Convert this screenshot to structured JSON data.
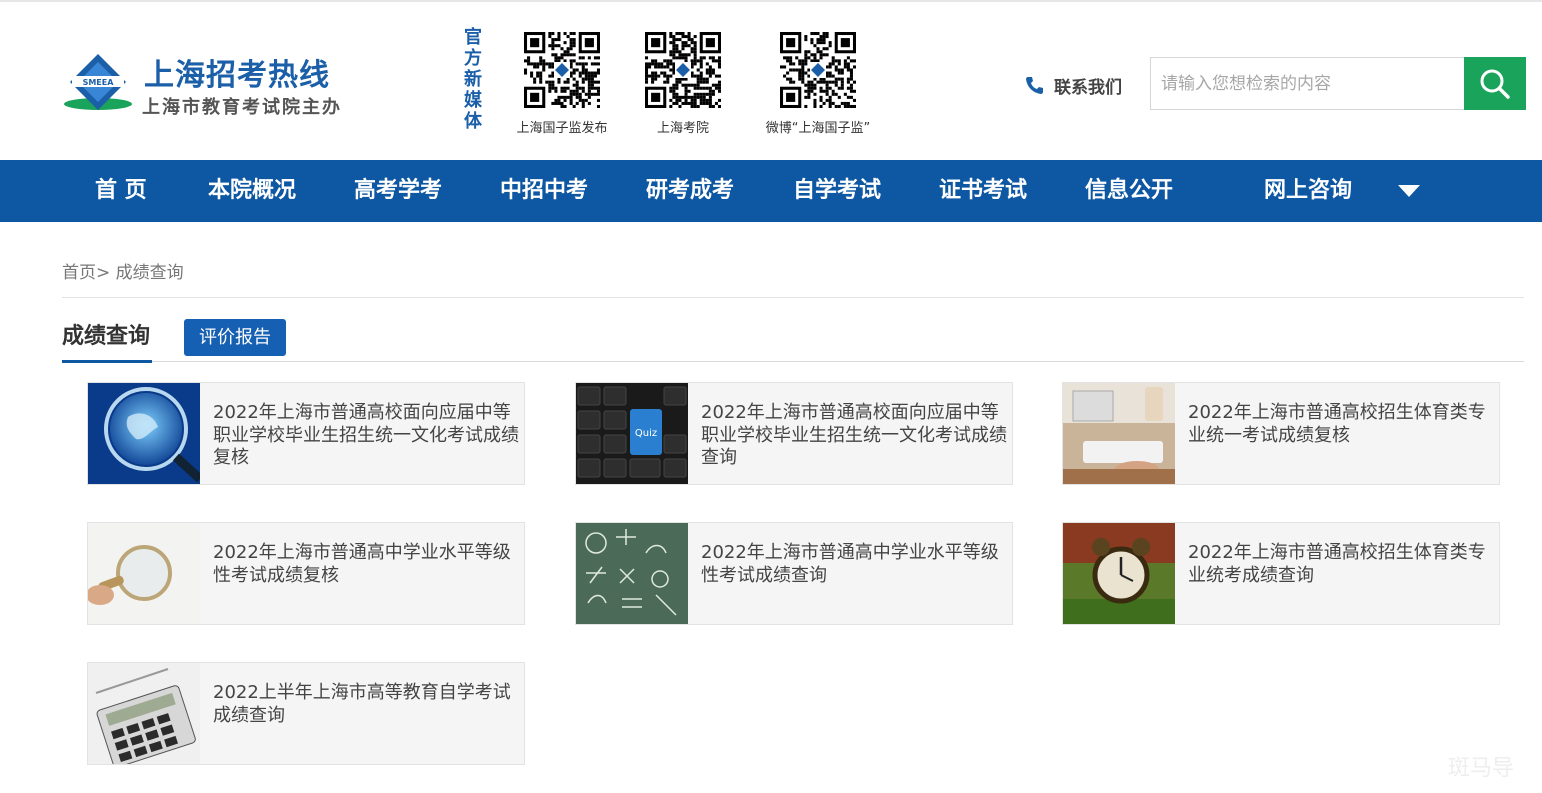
{
  "header": {
    "logo_title": "上海招考热线",
    "logo_sub": "上海市教育考试院主办",
    "logo_badge": "SMEEA",
    "media_label": "官方新媒体",
    "qr_codes": [
      {
        "caption": "上海国子监发布"
      },
      {
        "caption": "上海考院"
      },
      {
        "caption": "微博“上海国子监”"
      }
    ],
    "contact_label": "联系我们",
    "search_placeholder": "请输入您想检索的内容"
  },
  "nav": {
    "items": [
      "首 页",
      "本院概况",
      "高考学考",
      "中招中考",
      "研考成考",
      "自学考试",
      "证书考试",
      "信息公开",
      "网上咨询"
    ]
  },
  "breadcrumb": {
    "home": "首页",
    "separator": ">",
    "current": "成绩查询"
  },
  "tabs": {
    "active": "成绩查询",
    "other": "评价报告"
  },
  "cards": [
    {
      "title": "2022年上海市普通高校面向应届中等职业学校毕业生招生统一文化考试成绩复核"
    },
    {
      "title": "2022年上海市普通高校面向应届中等职业学校毕业生招生统一文化考试成绩查询"
    },
    {
      "title": "2022年上海市普通高校招生体育类专业统一考试成绩复核"
    },
    {
      "title": "2022年上海市普通高中学业水平等级性考试成绩复核"
    },
    {
      "title": "2022年上海市普通高中学业水平等级性考试成绩查询"
    },
    {
      "title": "2022年上海市普通高校招生体育类专业统考成绩查询"
    },
    {
      "title": "2022上半年上海市高等教育自学考试成绩查询"
    }
  ],
  "watermark": "斑马导",
  "colors": {
    "brand_blue": "#0e57a2",
    "search_green": "#1aa35a",
    "button_blue": "#1660b3"
  }
}
